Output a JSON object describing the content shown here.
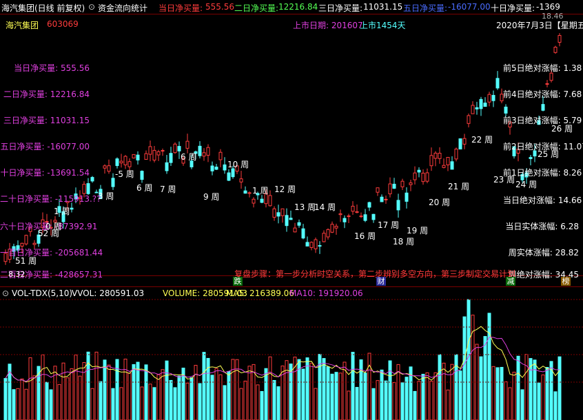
{
  "topbar": {
    "stock_title": "海汽集团(日线 前复权)",
    "indicator_name": "资金流向统计",
    "d1_label": "当日净买量: ",
    "d1_value": "555.56",
    "d2_label": "二日净买量: ",
    "d2_value": "12216.84",
    "d3_label": "三日净买量: ",
    "d3_value": "11031.15",
    "d5_label": "五日净买量: ",
    "d5_value": "-16077.00",
    "d10_label": "十日净买量: ",
    "d10_value": "-1369",
    "corner_value": "18.46"
  },
  "header": {
    "name": "海汽集团",
    "code": "603069",
    "ipo_date": "上市日期: 201607",
    "ipo_days": "上市1454天",
    "date": "2020年7月3日【星期五"
  },
  "left_labels": [
    "当日净买量: 555.56",
    "二日净买量: 12216.84",
    "三日净买量: 11031.15",
    "五日净买量: -16077.00",
    "十日净买量: -13691.54",
    "二十日净买量: -115913.??",
    "六十日净买量: -87392.91",
    "一百日净买量: -205681.44",
    "二百日净买量: -428657.31"
  ],
  "right_labels": [
    "前5日绝对涨幅: 1.38",
    "前4日绝对涨幅: 7.68",
    "前3日绝对涨幅: 5.79",
    "前2日绝对涨幅: 11.07",
    "前1日绝对涨幅: 8.26",
    "当日绝对涨幅: 14.66",
    "当日实体涨幅: 6.28",
    "周实体涨幅: 28.82",
    "周绝对涨幅: 34.45"
  ],
  "week_labels": [
    "51 周",
    "52 周",
    "1 周",
    "0 周",
    "-5 周",
    "6 周",
    "7 周",
    "3 周",
    "6 周",
    "9 周",
    "10 周",
    "1 周",
    "12 周",
    "13 周",
    "14 周",
    "16 周",
    "17 周",
    "18 周",
    "19 周",
    "20 周",
    "21 周",
    "22 周",
    "23 周",
    "24 周",
    "25 周",
    "26 周"
  ],
  "price_low_label": "8.32",
  "review_text": "复盘步骤：第一步分析时空关系，第二步辨别多空方向，第三步制定交易计划",
  "markers": {
    "die": "跌",
    "cai": "财",
    "jian": "减",
    "bang": "榜"
  },
  "volume": {
    "indicator": "VOL-TDX(5,10)",
    "vvol": "VVOL: 280591.03",
    "volume": "VOLUME: 280591.03",
    "ma5": "MA5: 216389.06",
    "ma10": "MA10: 191920.06"
  },
  "colors": {
    "up": "#ff3c3c",
    "down": "#54ffff",
    "magenta": "#e040e0",
    "yellow": "#ffff54",
    "grid": "#7a0000"
  }
}
